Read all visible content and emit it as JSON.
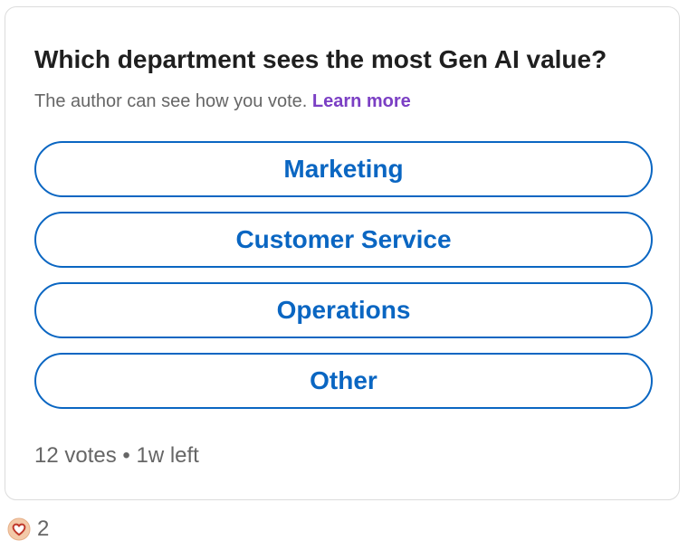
{
  "poll": {
    "question": "Which department sees the most Gen AI value?",
    "privacy_text": "The author can see how you vote.",
    "learn_more_label": "Learn more",
    "options": [
      {
        "label": "Marketing"
      },
      {
        "label": "Customer Service"
      },
      {
        "label": "Operations"
      },
      {
        "label": "Other"
      }
    ],
    "votes_text": "12 votes",
    "separator": "•",
    "time_left_text": "1w left"
  },
  "reactions": {
    "icon": "love-heart-icon",
    "count": "2",
    "colors": {
      "heart_fill": "#f3c9a8",
      "heart_outline": "#c0392b"
    }
  },
  "colors": {
    "accent": "#0a66c2",
    "link": "#7b3fc4",
    "text_primary": "#1f1f1f",
    "text_secondary": "#666666",
    "card_border": "#dcdcdc"
  }
}
